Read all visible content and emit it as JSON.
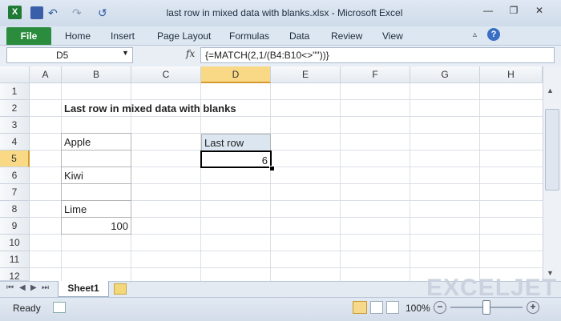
{
  "window": {
    "title": "last row in mixed data with blanks.xlsx - Microsoft Excel",
    "minimize_glyph": "—",
    "restore_glyph": "❐",
    "close_glyph": "✕"
  },
  "quick_access": {
    "undo_glyph": "↶",
    "redo_glyph": "↷",
    "refresh_glyph": "↺"
  },
  "ribbon": {
    "file": "File",
    "tabs": [
      "Home",
      "Insert",
      "Page Layout",
      "Formulas",
      "Data",
      "Review",
      "View"
    ]
  },
  "formula_bar": {
    "name_box": "D5",
    "fx": "fx",
    "formula": "{=MATCH(2,1/(B4:B10<>\"\"))}"
  },
  "columns": [
    "A",
    "B",
    "C",
    "D",
    "E",
    "F",
    "G",
    "H"
  ],
  "rows": [
    "1",
    "2",
    "3",
    "4",
    "5",
    "6",
    "7",
    "8",
    "9",
    "10",
    "11",
    "12"
  ],
  "cells": {
    "B2": "Last row in mixed data with blanks",
    "B4": "Apple",
    "B6": "Kiwi",
    "B8": "Lime",
    "B9": "100",
    "D4": "Last row",
    "D5": "6"
  },
  "sheet_tabs": {
    "active": "Sheet1"
  },
  "status": {
    "ready": "Ready",
    "zoom": "100%"
  },
  "watermark": "EXCELJET",
  "colors": {
    "file_tab": "#2a8c3c",
    "selection_header": "#f9d986",
    "header_cell_fill": "#dce6f1"
  }
}
